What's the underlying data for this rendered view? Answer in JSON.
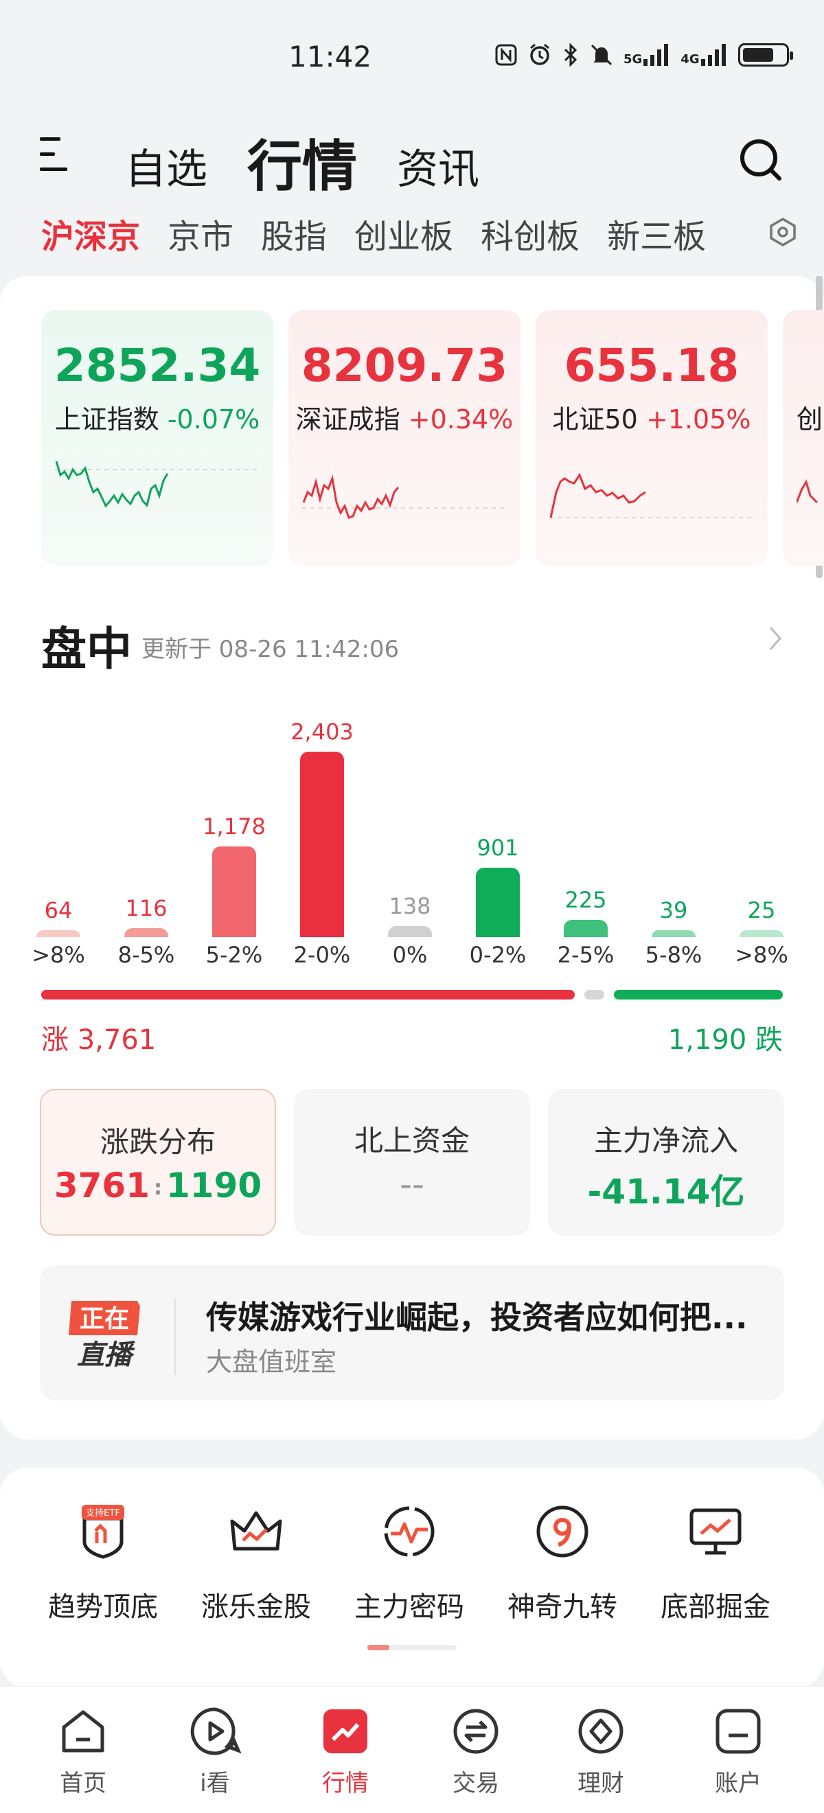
{
  "status_bar": {
    "time": "11:42",
    "net1": "5G",
    "net2": "4G"
  },
  "header": {
    "tabs": [
      {
        "label": "自选"
      },
      {
        "label": "行情",
        "active": true
      },
      {
        "label": "资讯"
      }
    ]
  },
  "subtabs": [
    "沪深京",
    "京市",
    "股指",
    "创业板",
    "科创板",
    "新三板"
  ],
  "indices": [
    {
      "value": "2852.34",
      "name": "上证指数",
      "change": "-0.07%",
      "trend": "down"
    },
    {
      "value": "8209.73",
      "name": "深证成指",
      "change": "+0.34%",
      "trend": "up"
    },
    {
      "value": "655.18",
      "name": "北证50",
      "change": "+1.05%",
      "trend": "up"
    },
    {
      "name_partial": "创"
    }
  ],
  "panzhong": {
    "title": "盘中",
    "update": "更新于 08-26 11:42:06"
  },
  "chart_data": {
    "type": "bar",
    "categories": [
      ">8%",
      "8-5%",
      "5-2%",
      "2-0%",
      "0%",
      "0-2%",
      "2-5%",
      "5-8%",
      ">8%"
    ],
    "values": [
      64,
      116,
      1178,
      2403,
      138,
      901,
      225,
      39,
      25
    ],
    "labels": [
      "64",
      "116",
      "1,178",
      "2,403",
      "138",
      "901",
      "225",
      "39",
      "25"
    ],
    "colors": [
      "#f9c9c6",
      "#f39b98",
      "#f2666d",
      "#ea3040",
      "#d0d0d0",
      "#10ad59",
      "#3fc07b",
      "#8fdcb3",
      "#b8e8cd"
    ],
    "label_colors": [
      "#e8323d",
      "#e8323d",
      "#e8323d",
      "#e8323d",
      "#999999",
      "#0ea55b",
      "#0ea55b",
      "#0ea55b",
      "#0ea55b"
    ],
    "rise_count": 3761,
    "flat_count": 138,
    "fall_count": 1190
  },
  "summary": {
    "rise_label": "涨 3,761",
    "fall_label": "1,190 跌"
  },
  "stats": [
    {
      "title": "涨跌分布",
      "value_up": "3761",
      "sep": ":",
      "value_down": "1190"
    },
    {
      "title": "北上资金",
      "value": "--"
    },
    {
      "title": "主力净流入",
      "value": "-41.14亿"
    }
  ],
  "live": {
    "badge_top": "正在",
    "badge_bottom": "直播",
    "title": "传媒游戏行业崛起，投资者应如何把...",
    "subtitle": "大盘值班室"
  },
  "tools": [
    {
      "label": "趋势顶底",
      "badge": "支持ETF",
      "icon": "shield-chart-icon"
    },
    {
      "label": "涨乐金股",
      "icon": "crown-icon"
    },
    {
      "label": "主力密码",
      "icon": "pulse-icon"
    },
    {
      "label": "神奇九转",
      "icon": "nine-icon"
    },
    {
      "label": "底部掘金",
      "icon": "monitor-chart-icon"
    }
  ],
  "bottom_nav": [
    {
      "label": "首页",
      "icon": "home-icon"
    },
    {
      "label": "i看",
      "icon": "play-icon"
    },
    {
      "label": "行情",
      "icon": "market-icon",
      "active": true
    },
    {
      "label": "交易",
      "icon": "exchange-icon"
    },
    {
      "label": "理财",
      "icon": "wealth-icon"
    },
    {
      "label": "账户",
      "icon": "account-icon"
    }
  ],
  "colors": {
    "red": "#e8323d",
    "green": "#0ea55b",
    "accent": "#e8323d"
  }
}
